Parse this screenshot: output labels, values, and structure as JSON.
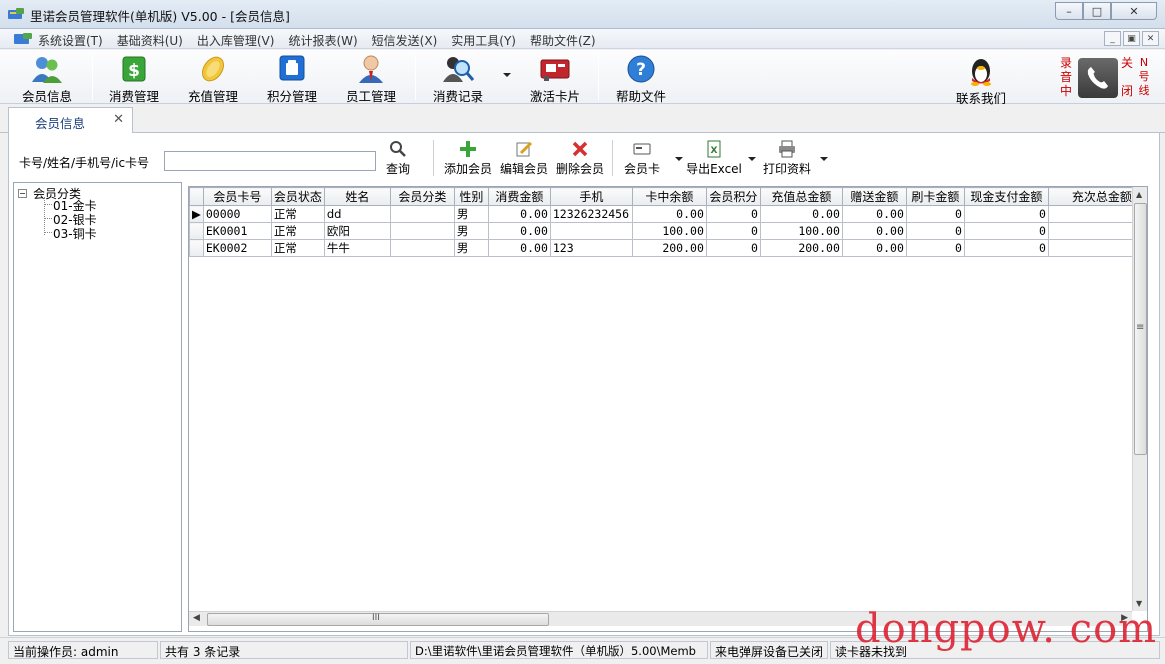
{
  "window": {
    "title": "里诺会员管理软件(单机版) V5.00 - [会员信息]",
    "minimize": "–",
    "maximize": "□",
    "close": "✕"
  },
  "menu": [
    "系统设置(T)",
    "基础资料(U)",
    "出入库管理(V)",
    "统计报表(W)",
    "短信发送(X)",
    "实用工具(Y)",
    "帮助文件(Z)"
  ],
  "toolbar": {
    "member_info": "会员信息",
    "consume": "消费管理",
    "recharge": "充值管理",
    "points": "积分管理",
    "staff": "员工管理",
    "records": "消费记录",
    "activate": "激活卡片",
    "help": "帮助文件",
    "contact": "联系我们"
  },
  "phone_widget": {
    "left_text": [
      "录",
      "音",
      "中"
    ],
    "right_text_a": [
      "关",
      "闭"
    ],
    "right_text_b": [
      "N",
      "号",
      "线"
    ]
  },
  "tab": {
    "label": "会员信息",
    "close": "✕"
  },
  "search": {
    "label": "卡号/姓名/手机号/ic卡号",
    "value": "",
    "query": "查询"
  },
  "actions": {
    "add": "添加会员",
    "edit": "编辑会员",
    "delete": "删除会员",
    "card": "会员卡",
    "export": "导出Excel",
    "print": "打印资料"
  },
  "tree": {
    "root": "会员分类",
    "children": [
      "01-金卡",
      "02-银卡",
      "03-铜卡"
    ]
  },
  "table": {
    "columns": [
      "会员卡号",
      "会员状态",
      "姓名",
      "会员分类",
      "性别",
      "消费金额",
      "手机",
      "卡中余额",
      "会员积分",
      "充值总金额",
      "赠送金额",
      "刷卡金额",
      "现金支付金额",
      "充次总金额"
    ],
    "rows": [
      [
        "00000",
        "正常",
        "dd",
        "",
        "男",
        "0.00",
        "12326232456",
        "0.00",
        "0",
        "0.00",
        "0.00",
        "0",
        "0",
        ""
      ],
      [
        "EK0001",
        "正常",
        "欧阳",
        "",
        "男",
        "0.00",
        "",
        "100.00",
        "0",
        "100.00",
        "0.00",
        "0",
        "0",
        ""
      ],
      [
        "EK0002",
        "正常",
        "牛牛",
        "",
        "男",
        "0.00",
        "123",
        "200.00",
        "0",
        "200.00",
        "0.00",
        "0",
        "0",
        ""
      ]
    ],
    "selected_row_marker": "▶"
  },
  "scroll": {
    "h_grip": "III",
    "v_grip": "≡"
  },
  "status": {
    "operator": "当前操作员: admin",
    "count": "共有 3 条记录",
    "path": "D:\\里诺软件\\里诺会员管理软件（单机版）5.00\\Memb",
    "popup": "来电弹屏设备已关闭",
    "reader": "读卡器未找到"
  },
  "watermark": "dongpow. com"
}
